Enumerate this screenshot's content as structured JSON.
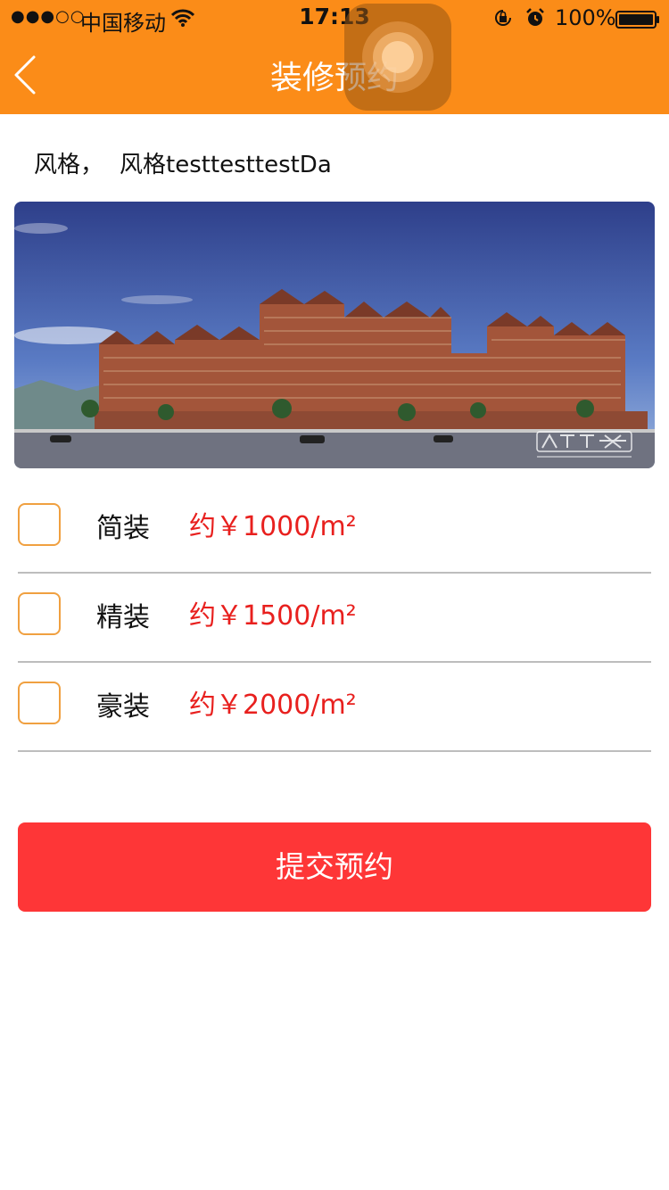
{
  "status_bar": {
    "signal": "●●●○○",
    "carrier": "中国移动",
    "time": "17:13",
    "battery": "100%"
  },
  "nav": {
    "title": "装修预约"
  },
  "style": {
    "prefix": "风格，",
    "value": "风格testtesttestDa"
  },
  "hero_image": {
    "watermark": "安居客",
    "watermark_sub": "anjuke.com"
  },
  "options": [
    {
      "name": "简装",
      "price": "约￥1000/m²"
    },
    {
      "name": "精装",
      "price": "约￥1500/m²"
    },
    {
      "name": "豪装",
      "price": "约￥2000/m²"
    }
  ],
  "submit": {
    "label": "提交预约"
  },
  "colors": {
    "nav_background": "#fb8c18",
    "price": "#e8201e",
    "submit_background": "#fe3637",
    "checkbox_border": "#f0a040"
  }
}
